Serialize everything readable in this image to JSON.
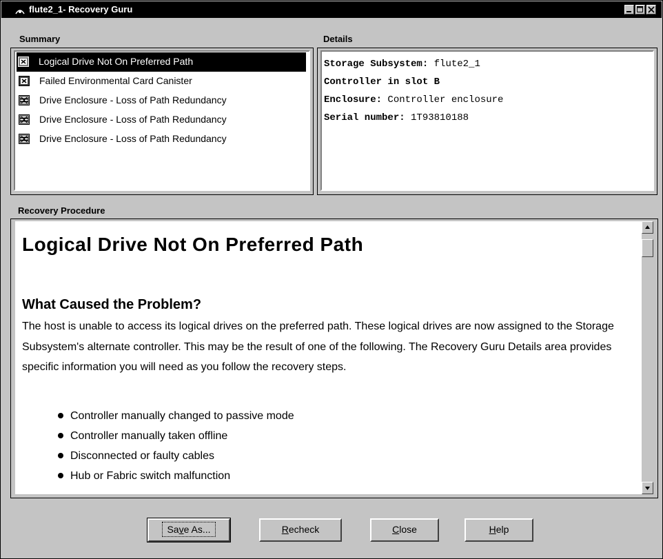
{
  "window": {
    "title": "flute2_1- Recovery Guru"
  },
  "summary": {
    "label": "Summary",
    "items": [
      {
        "text": "Logical Drive Not On Preferred Path",
        "icon": "controller-fault-icon",
        "selected": true
      },
      {
        "text": "Failed Environmental Card Canister",
        "icon": "controller-fault-icon",
        "selected": false
      },
      {
        "text": "Drive Enclosure - Loss of Path Redundancy",
        "icon": "enclosure-fault-icon",
        "selected": false
      },
      {
        "text": "Drive Enclosure - Loss of Path Redundancy",
        "icon": "enclosure-fault-icon",
        "selected": false
      },
      {
        "text": "Drive Enclosure - Loss of Path Redundancy",
        "icon": "enclosure-fault-icon",
        "selected": false
      }
    ]
  },
  "details": {
    "label": "Details",
    "rows": [
      {
        "key": "Storage Subsystem:",
        "value": " flute2_1"
      },
      {
        "key": "Controller in slot B",
        "value": ""
      },
      {
        "key": "Enclosure:",
        "value": " Controller enclosure"
      },
      {
        "key": "Serial number:",
        "value": " 1T93810188"
      }
    ]
  },
  "procedure": {
    "label": "Recovery Procedure",
    "heading": "Logical Drive Not On Preferred Path",
    "subheading": "What Caused the Problem?",
    "paragraph": "The host is unable to access its logical drives on the preferred path. These logical drives are now assigned to the Storage Subsystem's alternate controller. This may be the result of one of the following. The Recovery Guru Details area provides specific information you will need as you follow the recovery steps.",
    "bullets": [
      "Controller manually changed to passive mode",
      "Controller manually taken offline",
      "Disconnected or faulty cables",
      "Hub or Fabric switch malfunction"
    ]
  },
  "buttons": {
    "save_as": {
      "pre": "Sa",
      "mnemonic": "v",
      "post": "e As..."
    },
    "recheck": {
      "pre": "",
      "mnemonic": "R",
      "post": "echeck"
    },
    "close": {
      "pre": "",
      "mnemonic": "C",
      "post": "lose"
    },
    "help": {
      "pre": "",
      "mnemonic": "H",
      "post": "elp"
    }
  },
  "colors": {
    "window_bg": "#c4c4c4",
    "titlebar": "#000000",
    "selection": "#000000"
  }
}
